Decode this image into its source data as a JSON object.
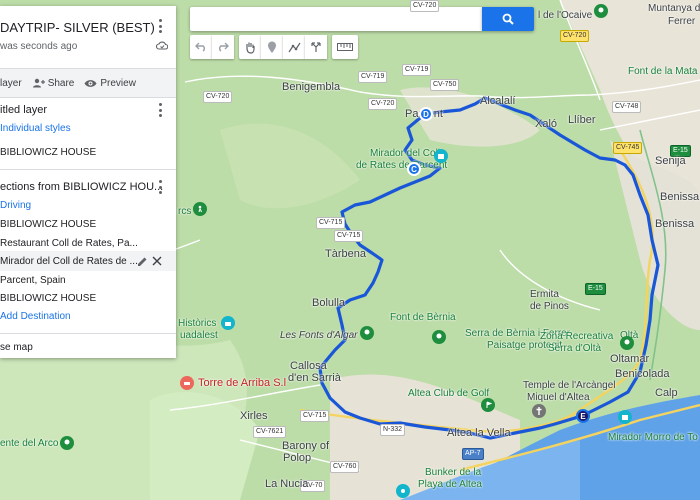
{
  "toolbar": {
    "search_placeholder": "",
    "tools": [
      "undo-icon",
      "redo-icon",
      "hand-icon",
      "pin-icon",
      "line-icon",
      "directions-icon",
      "ruler-icon"
    ]
  },
  "panel": {
    "title": "DAYTRIP- SILVER (BEST)",
    "saved": "was seconds ago",
    "actions": {
      "add_layer": "layer",
      "share": "Share",
      "preview": "Preview"
    },
    "layer1": {
      "name": "itled layer",
      "style": "Individual styles",
      "items": [
        "BIBLIOWICZ HOUSE"
      ]
    },
    "layer2": {
      "name": "ections from BIBLIOWICZ HOU...",
      "mode": "Driving",
      "stops": [
        "BIBLIOWICZ HOUSE",
        "Restaurant Coll de Rates, Pa...",
        "Mirador del Coll de Rates de ...",
        "Parcent, Spain",
        "BIBLIOWICZ HOUSE"
      ],
      "add_destination": "Add Destination"
    },
    "base_map": "se map"
  },
  "map": {
    "places": {
      "benigembla": "Benigembla",
      "parcent": "Parcent",
      "alcalali": "Alcalalí",
      "xalo": "Xaló",
      "lliber": "Llíber",
      "senija": "Senija",
      "benissa": "Benissa",
      "ocaive": "l de l'Ocaive",
      "muntanya1": "Muntanya d",
      "muntanya2": "Ferrer",
      "font_mata": "Font de la Mata",
      "mirador1": "Mirador del Coll",
      "mirador2": "de Rates de Parcent",
      "tarbena": "Tàrbena",
      "bolulla": "Bolulla",
      "orcs": "rcs",
      "historics1": "Històrics",
      "historics2": "uadalest",
      "fonts_algar": "Les Fonts d'Algar",
      "font_bernia": "Font de Bèrnia",
      "serra_bernia1": "Serra de Bèrnia i Ferrer",
      "serra_bernia2": "Paisatge protegit",
      "ermita1": "Ermita",
      "ermita2": "de Pinos",
      "oltaa": "Oltà",
      "zona1": "Zona Recreativa",
      "zona2": "Serra d'Oltà",
      "oltamar": "Oltamar",
      "benicolada": "Benicolada",
      "calp": "Calp",
      "callosa1": "Callosa",
      "callosa2": "d'en Sarrià",
      "torre": "Torre de Arriba S.l",
      "altea_golf": "Altea Club de Golf",
      "temple1": "Temple de l'Arcàngel",
      "temple2": "Miquel d'Altea",
      "mirador_morro": "Mirador Morro de To",
      "xirles": "Xirles",
      "barony1": "Barony of",
      "barony2": "Polop",
      "altea_vella": "Altea la Vella",
      "arco": "ente del Arco",
      "bunker1": "Bunker de la",
      "bunker2": "Playa de Altea",
      "nucia": "La Nucia"
    },
    "roads": {
      "cv720_top": "CV-720",
      "cv719": "CV-719",
      "cv750": "CV-750",
      "cv720_a": "CV-720",
      "cv720_b": "CV-720",
      "cv745": "CV-745",
      "cv748": "CV-748",
      "cv720_c": "CV-720",
      "e15_a": "E-15",
      "e15_b": "E-15",
      "cv715_a": "CV-715",
      "cv715_b": "CV-715",
      "cv7621": "CV-7621",
      "cv760": "CV-760",
      "ap7": "AP-7",
      "n332": "N-332",
      "cv70": "CV-70",
      "cv715_c": "CV-715"
    },
    "markers": {
      "c": "C",
      "d": "D",
      "e": "E"
    },
    "route_color": "#1a73e8"
  }
}
